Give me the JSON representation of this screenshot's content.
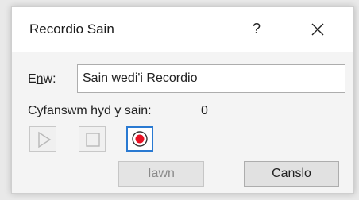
{
  "dialog": {
    "title": "Recordio Sain",
    "help_label": "?",
    "close_icon": "close-icon"
  },
  "name_field": {
    "label_first": "E",
    "label_accel": "n",
    "label_rest": "w:",
    "value": "Sain wedi'i Recordio"
  },
  "duration": {
    "label": "Cyfanswm hyd y sain:",
    "value": "0"
  },
  "controls": {
    "play_icon": "play-icon",
    "stop_icon": "stop-icon",
    "record_icon": "record-icon",
    "record_color": "#e81123",
    "focus_color": "#2a7ad2"
  },
  "buttons": {
    "ok_label": "Iawn",
    "cancel_label": "Canslo"
  }
}
